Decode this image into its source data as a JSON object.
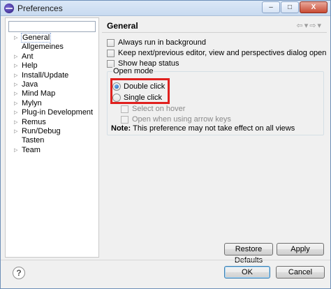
{
  "window": {
    "title": "Preferences",
    "minimize_label": "–",
    "maximize_label": "□",
    "close_label": "X"
  },
  "tree": {
    "filter_value": "",
    "items": [
      {
        "label": "General",
        "expandable": true,
        "selected": true
      },
      {
        "label": "Allgemeines",
        "expandable": false,
        "selected": false
      },
      {
        "label": "Ant",
        "expandable": true,
        "selected": false
      },
      {
        "label": "Help",
        "expandable": true,
        "selected": false
      },
      {
        "label": "Install/Update",
        "expandable": true,
        "selected": false
      },
      {
        "label": "Java",
        "expandable": true,
        "selected": false
      },
      {
        "label": "Mind Map",
        "expandable": true,
        "selected": false
      },
      {
        "label": "Mylyn",
        "expandable": true,
        "selected": false
      },
      {
        "label": "Plug-in Development",
        "expandable": true,
        "selected": false
      },
      {
        "label": "Remus",
        "expandable": true,
        "selected": false
      },
      {
        "label": "Run/Debug",
        "expandable": true,
        "selected": false
      },
      {
        "label": "Tasten",
        "expandable": false,
        "selected": false
      },
      {
        "label": "Team",
        "expandable": true,
        "selected": false
      }
    ]
  },
  "page": {
    "title": "General",
    "nav": {
      "back": "⇦",
      "back_menu": "▾",
      "forward": "⇨",
      "forward_menu": "▾"
    },
    "checkboxes": [
      {
        "label": "Always run in background",
        "checked": false
      },
      {
        "label": "Keep next/previous editor, view and perspectives dialog open",
        "checked": false
      },
      {
        "label": "Show heap status",
        "checked": false
      }
    ],
    "open_mode": {
      "label": "Open mode",
      "options": [
        {
          "label": "Double click",
          "selected": true
        },
        {
          "label": "Single click",
          "selected": false
        }
      ],
      "sub_options": [
        {
          "label": "Select on hover",
          "enabled": false
        },
        {
          "label": "Open when using arrow keys",
          "enabled": false
        }
      ],
      "note_prefix": "Note:",
      "note_text": "This preference may not take effect on all views"
    },
    "restore_defaults_label": "Restore Defaults",
    "apply_label": "Apply"
  },
  "footer": {
    "help_label": "?",
    "ok_label": "OK",
    "cancel_label": "Cancel"
  },
  "colors": {
    "highlight_border": "#e0201e",
    "default_button_border": "#3c7fb1"
  }
}
